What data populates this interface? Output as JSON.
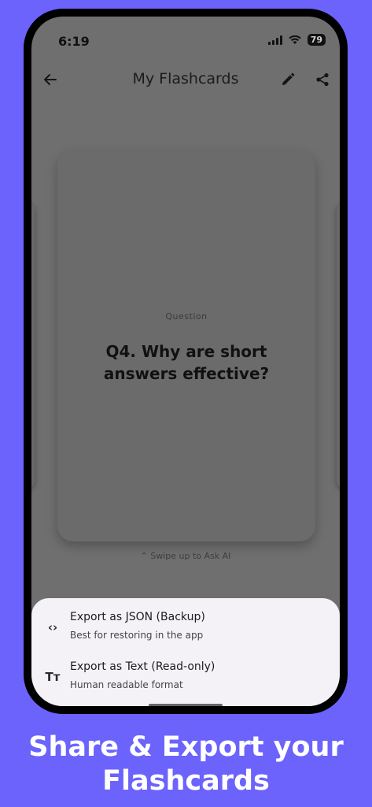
{
  "status_bar": {
    "time": "6:19",
    "battery": "79"
  },
  "appbar": {
    "title": "My Flashcards"
  },
  "card": {
    "label": "Question",
    "question": "Q4. Why are short answers effective?"
  },
  "swipe_hint": "⌃ Swipe up to Ask AI",
  "export_sheet": {
    "items": [
      {
        "title": "Export as JSON (Backup)",
        "subtitle": "Best for restoring in the app",
        "icon": "code-icon"
      },
      {
        "title": "Export as Text (Read-only)",
        "subtitle": "Human readable format",
        "icon": "text-format-icon"
      }
    ]
  },
  "caption": {
    "line1": "Share & Export your",
    "line2": "Flashcards"
  },
  "colors": {
    "background": "#6b63fb",
    "scrim": "#6f6f6f",
    "sheet": "#f4f2f6"
  }
}
